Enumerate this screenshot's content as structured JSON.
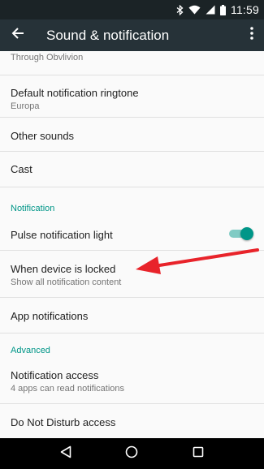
{
  "status_bar": {
    "time": "11:59",
    "icons": [
      "bluetooth-icon",
      "wifi-icon",
      "cellular-signal-icon",
      "battery-icon"
    ]
  },
  "app_bar": {
    "title": "Sound & notification",
    "back_icon": "arrow-back-icon",
    "menu_icon": "more-vert-icon"
  },
  "list": {
    "partial_item": "Through Obvlivion",
    "items": [
      {
        "primary": "Default notification ringtone",
        "secondary": "Europa"
      },
      {
        "primary": "Other sounds"
      },
      {
        "primary": "Cast"
      }
    ],
    "notification_header": "Notification",
    "notification_items": [
      {
        "primary": "Pulse notification light",
        "toggle": "on"
      },
      {
        "primary": "When device is locked",
        "secondary": "Show all notification content"
      },
      {
        "primary": "App notifications"
      }
    ],
    "advanced_header": "Advanced",
    "advanced_items": [
      {
        "primary": "Notification access",
        "secondary": "4 apps can read notifications"
      },
      {
        "primary": "Do Not Disturb access"
      }
    ]
  },
  "colors": {
    "accent": "#009688",
    "app_bar": "#263238",
    "status_bar": "#1b2326",
    "annotation_arrow": "#e8232a"
  },
  "nav_bar": {
    "icons": [
      "back-triangle-icon",
      "home-circle-icon",
      "recents-square-icon"
    ]
  }
}
